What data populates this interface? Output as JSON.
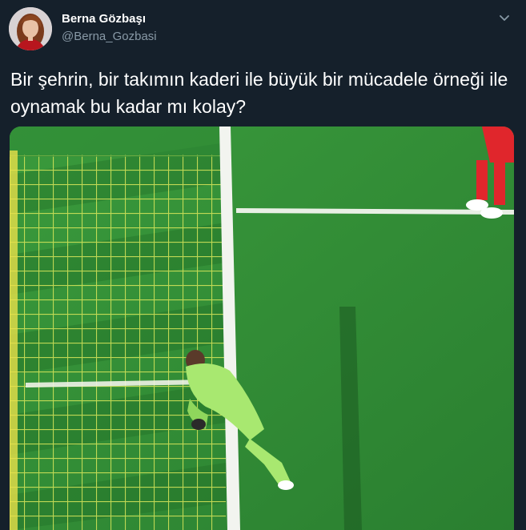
{
  "author": {
    "display_name": "Berna Gözbaşı",
    "handle": "@Berna_Gozbasi"
  },
  "tweet": {
    "text": "Bir şehrin, bir takımın kaderi ile büyük bir mücadele örneği ile oynamak bu kadar mı kolay?"
  },
  "icons": {
    "menu": "chevron-down-icon",
    "avatar": "profile-photo"
  },
  "colors": {
    "background": "#15202b",
    "secondary_text": "#8899a6",
    "primary_text": "#ffffff",
    "pitch": "#2f8a35",
    "goalkeeper_kit": "#a8e870",
    "opponent_kit": "#e0262c"
  }
}
